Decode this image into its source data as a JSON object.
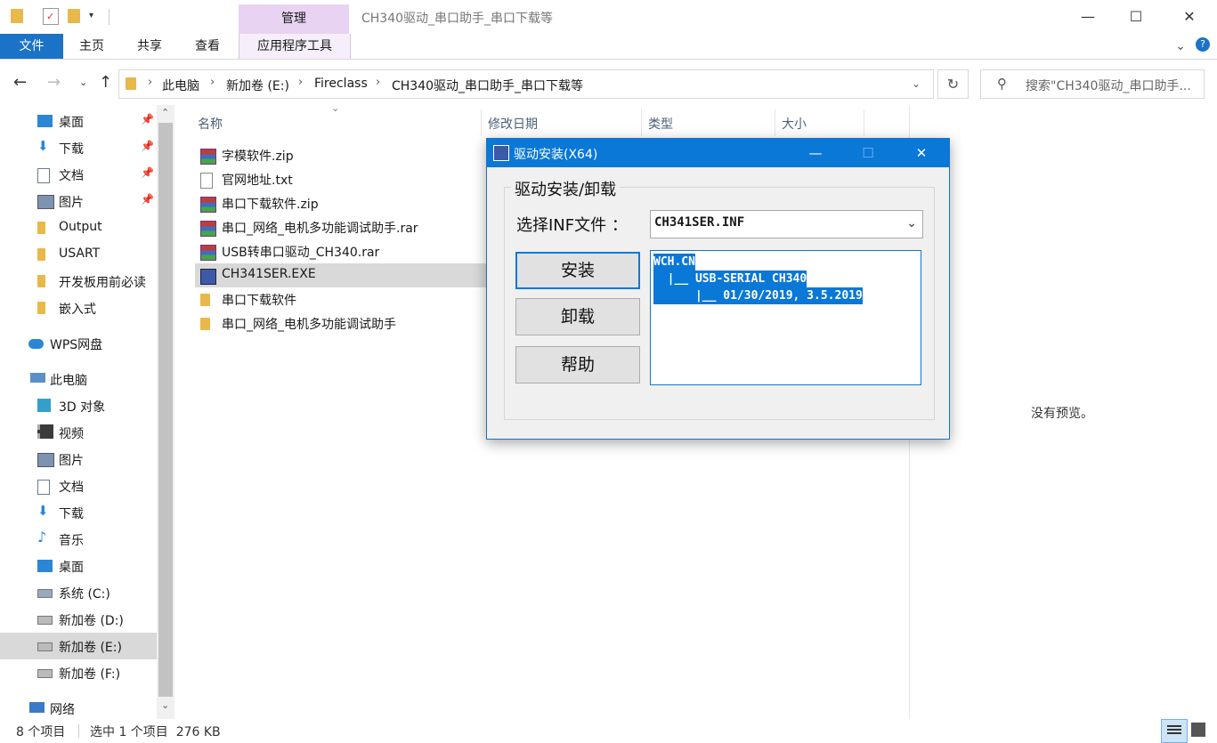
{
  "window": {
    "title": "CH340驱动_串口助手_串口下载等",
    "context_tab": "管理",
    "minimize": "—",
    "maximize": "☐",
    "close": "✕"
  },
  "ribbon": {
    "tabs": [
      "文件",
      "主页",
      "共享",
      "查看",
      "应用程序工具"
    ],
    "expand": "⌄",
    "help": "?"
  },
  "address": {
    "breadcrumbs": [
      "此电脑",
      "新加卷 (E:)",
      "Fireclass",
      "CH340驱动_串口助手_串口下载等"
    ],
    "search_placeholder": "搜索\"CH340驱动_串口助手..."
  },
  "navpane": {
    "items": [
      {
        "label": "桌面",
        "pinned": true,
        "icon": "desktop-icon"
      },
      {
        "label": "下载",
        "pinned": true,
        "icon": "download-icon"
      },
      {
        "label": "文档",
        "pinned": true,
        "icon": "document-icon"
      },
      {
        "label": "图片",
        "pinned": true,
        "icon": "picture-icon"
      },
      {
        "label": "Output",
        "icon": "folder-icon"
      },
      {
        "label": "USART",
        "icon": "folder-icon"
      },
      {
        "label": "开发板用前必读",
        "icon": "folder-icon"
      },
      {
        "label": "嵌入式",
        "icon": "folder-icon"
      },
      {
        "label": "WPS网盘",
        "icon": "cloud-icon"
      },
      {
        "label": "此电脑",
        "icon": "computer-icon"
      },
      {
        "label": "3D 对象",
        "icon": "3d-objects-icon"
      },
      {
        "label": "视频",
        "icon": "video-icon"
      },
      {
        "label": "图片",
        "icon": "picture-icon"
      },
      {
        "label": "文档",
        "icon": "document-icon"
      },
      {
        "label": "下载",
        "icon": "download-icon"
      },
      {
        "label": "音乐",
        "icon": "music-icon"
      },
      {
        "label": "桌面",
        "icon": "desktop-icon"
      },
      {
        "label": "系统 (C:)",
        "icon": "drive-icon"
      },
      {
        "label": "新加卷 (D:)",
        "icon": "drive-icon"
      },
      {
        "label": "新加卷 (E:)",
        "icon": "drive-icon",
        "selected": true
      },
      {
        "label": "新加卷 (F:)",
        "icon": "drive-icon"
      },
      {
        "label": "网络",
        "icon": "network-icon"
      }
    ]
  },
  "filelist": {
    "columns": [
      "名称",
      "修改日期",
      "类型",
      "大小"
    ],
    "files": [
      {
        "name": "字模软件.zip",
        "icon": "archive-icon"
      },
      {
        "name": "官网地址.txt",
        "icon": "text-file-icon"
      },
      {
        "name": "串口下载软件.zip",
        "icon": "archive-icon"
      },
      {
        "name": "串口_网络_电机多功能调试助手.rar",
        "icon": "archive-icon"
      },
      {
        "name": "USB转串口驱动_CH340.rar",
        "icon": "archive-icon"
      },
      {
        "name": "CH341SER.EXE",
        "icon": "exe-icon",
        "selected": true
      },
      {
        "name": "串口下载软件",
        "icon": "folder-icon"
      },
      {
        "name": "串口_网络_电机多功能调试助手",
        "icon": "folder-icon"
      }
    ]
  },
  "preview": {
    "empty_text": "没有预览。"
  },
  "status": {
    "count": "8 个项目",
    "selection": "选中 1 个项目  276 KB"
  },
  "dialog": {
    "title": "驱动安装(X64)",
    "group_title": "驱动安装/卸载",
    "inf_label": "选择INF文件 ：",
    "inf_value": "CH341SER.INF",
    "buttons": {
      "install": "安装",
      "uninstall": "卸载",
      "help": "帮助"
    },
    "info_lines": [
      "WCH.CN",
      "  |__ USB-SERIAL CH340",
      "      |__ 01/30/2019, 3.5.2019"
    ],
    "minimize": "—",
    "maximize": "☐",
    "close": "✕"
  },
  "colors": {
    "accent": "#0a78d7",
    "manage_tab": "#e8d3f3",
    "selected_row": "#d9d9d9"
  }
}
